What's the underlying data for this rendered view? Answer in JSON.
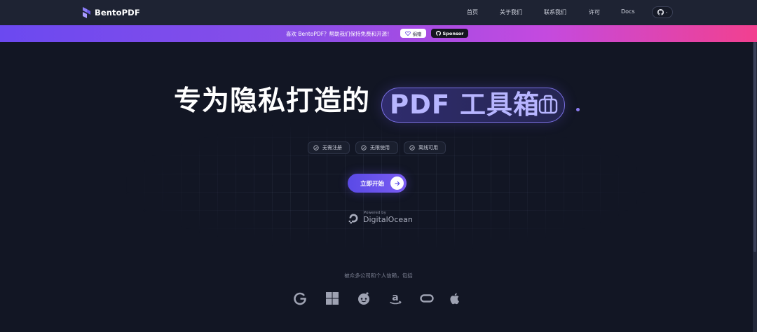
{
  "brand": {
    "name": "BentoPDF"
  },
  "nav": {
    "items": [
      "首页",
      "关于我们",
      "联系我们",
      "许可",
      "Docs"
    ],
    "github_count": "-"
  },
  "banner": {
    "text": "喜欢 BentoPDF？帮助我们保持免费和开源！",
    "donate_label": "捐赠",
    "sponsor_label": "Sponsor"
  },
  "hero": {
    "title": "专为隐私打造的",
    "highlight": "PDF 工具箱"
  },
  "features": [
    "无需注册",
    "无限使用",
    "离线可用"
  ],
  "cta": {
    "label": "立即开始"
  },
  "powered": {
    "small": "Powered by",
    "name": "DigitalOcean"
  },
  "trusted": {
    "text": "被众多公司和个人信赖，包括",
    "logos": [
      "google-icon",
      "windows-icon",
      "reddit-icon",
      "amazon-icon",
      "oculus-icon",
      "apple-icon"
    ]
  },
  "colors": {
    "background": "#121624",
    "navbar": "#1e2333",
    "accent": "#6b56f0",
    "highlight_text": "#b7b5ff",
    "banner_gradient": [
      "#6b49f0",
      "#f2408f"
    ]
  }
}
